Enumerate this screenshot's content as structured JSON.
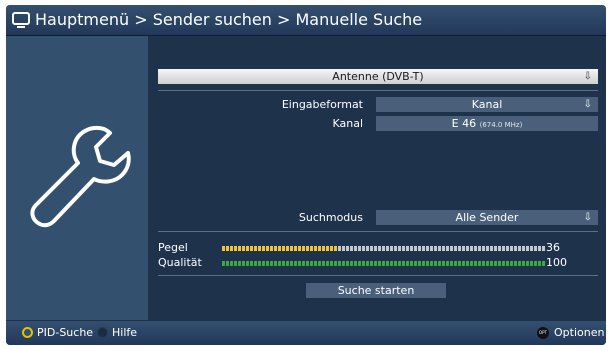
{
  "header": {
    "title": "Hauptmenü > Sender suchen > Manuelle Suche",
    "icon": "tv-icon"
  },
  "sidebar": {
    "icon": "wrench-icon"
  },
  "source": {
    "value": "Antenne (DVB-T)",
    "arrow": "⇩"
  },
  "form": {
    "input_format": {
      "label": "Eingabeformat",
      "value": "Kanal",
      "arrow": "⇩"
    },
    "channel": {
      "label": "Kanal",
      "value": "E 46",
      "freq": "(674.0 MHz)"
    },
    "search_mode": {
      "label": "Suchmodus",
      "value": "Alle Sender",
      "arrow": "⇩"
    }
  },
  "signal": {
    "level": {
      "label": "Pegel",
      "value": "36",
      "fraction": 0.36,
      "color": "#f2c534"
    },
    "quality": {
      "label": "Qualität",
      "value": "100",
      "fraction": 1.0,
      "color": "#3fa843"
    },
    "empty_color": "#c9c9c9",
    "segments": 81
  },
  "actions": {
    "start_search": "Suche starten"
  },
  "footer": {
    "yellow_label": "PID-Suche",
    "blue_label": "Hilfe",
    "opt_badge": "OPT",
    "options_label": "Optionen"
  }
}
